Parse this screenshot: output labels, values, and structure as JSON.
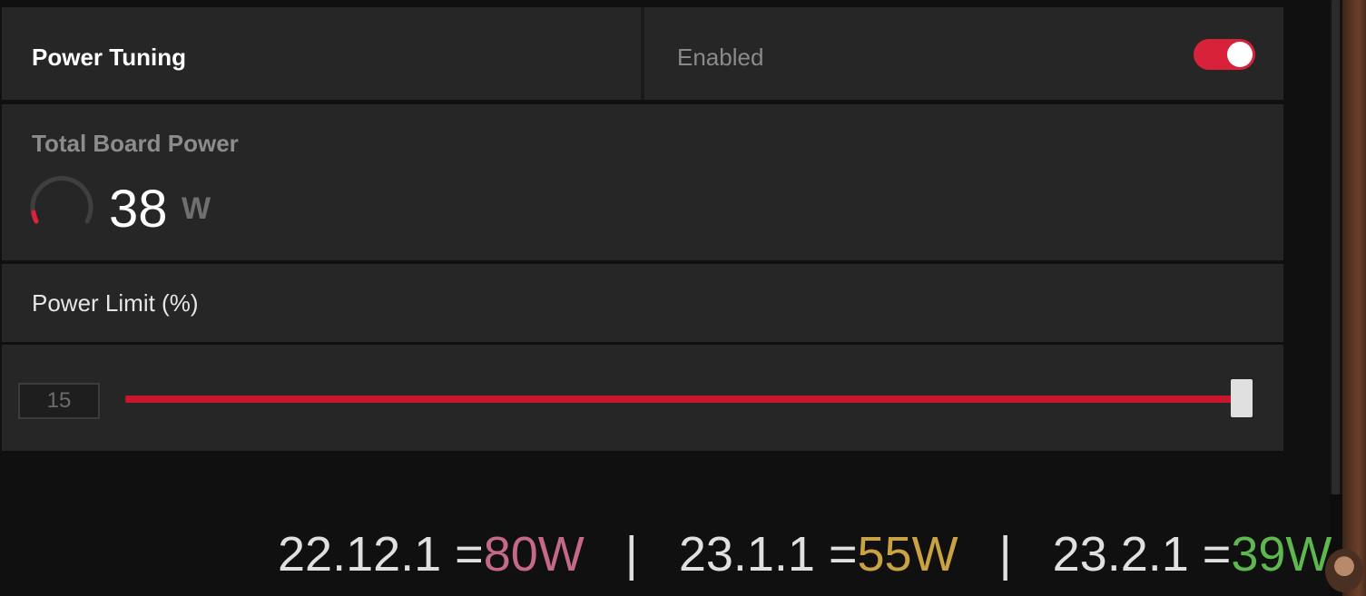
{
  "header": {
    "title": "Power Tuning",
    "status_label": "Enabled",
    "toggle_on": true
  },
  "total_board_power": {
    "label": "Total Board Power",
    "value": "38",
    "unit": "W",
    "gauge_fraction": 0.05
  },
  "power_limit": {
    "label": "Power Limit (%)",
    "value": "15",
    "slider_fraction": 1.0
  },
  "overlay": {
    "items": [
      {
        "version": "22.12.1 = ",
        "watts": "80W",
        "color": "#c46a86"
      },
      {
        "version": "23.1.1 = ",
        "watts": "55W",
        "color": "#c9a242"
      },
      {
        "version": "23.2.1 = ",
        "watts": "39W",
        "color": "#5fb84f"
      }
    ],
    "separator": "|"
  },
  "colors": {
    "accent": "#d8223a",
    "slider": "#c8162d"
  }
}
